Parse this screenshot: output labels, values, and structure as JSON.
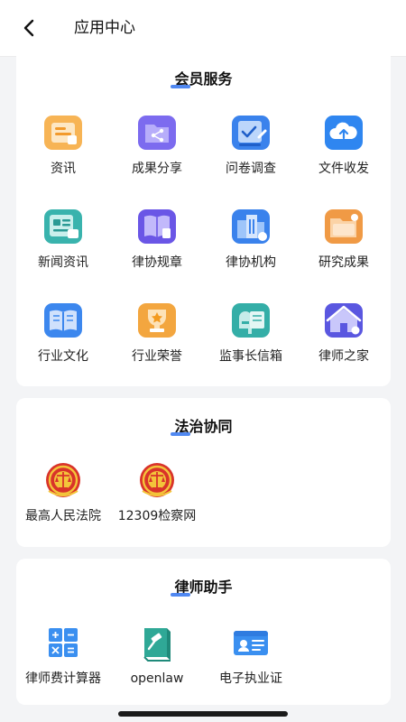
{
  "header": {
    "title": "应用中心",
    "back_icon": "chevron-left-icon"
  },
  "sections": [
    {
      "title": "会员服务",
      "items": [
        {
          "label": "资讯",
          "icon": "news-doc-icon"
        },
        {
          "label": "成果分享",
          "icon": "share-folder-icon"
        },
        {
          "label": "问卷调查",
          "icon": "survey-icon"
        },
        {
          "label": "文件收发",
          "icon": "cloud-upload-icon"
        },
        {
          "label": "新闻资讯",
          "icon": "news-icon"
        },
        {
          "label": "律协规章",
          "icon": "regulation-book-icon"
        },
        {
          "label": "律协机构",
          "icon": "building-icon"
        },
        {
          "label": "研究成果",
          "icon": "research-folder-icon"
        },
        {
          "label": "行业文化",
          "icon": "open-book-icon"
        },
        {
          "label": "行业荣誉",
          "icon": "trophy-icon"
        },
        {
          "label": "监事长信箱",
          "icon": "mailbox-icon"
        },
        {
          "label": "律师之家",
          "icon": "house-icon"
        }
      ]
    },
    {
      "title": "法治协同",
      "items": [
        {
          "label": "最高人民法院",
          "icon": "court-emblem-icon"
        },
        {
          "label": "12309检察网",
          "icon": "procuratorate-emblem-icon"
        }
      ]
    },
    {
      "title": "律师助手",
      "items": [
        {
          "label": "律师费计算器",
          "icon": "calculator-icon"
        },
        {
          "label": "openlaw",
          "icon": "openlaw-gavel-icon"
        },
        {
          "label": "电子执业证",
          "icon": "id-card-icon"
        }
      ]
    }
  ],
  "colors": {
    "accent": "#3d7bf0",
    "background": "#f3f4f6",
    "orange": "#f5a243",
    "purple": "#7b6cf0",
    "blue": "#3f8ef2",
    "teal": "#3db6b0"
  }
}
